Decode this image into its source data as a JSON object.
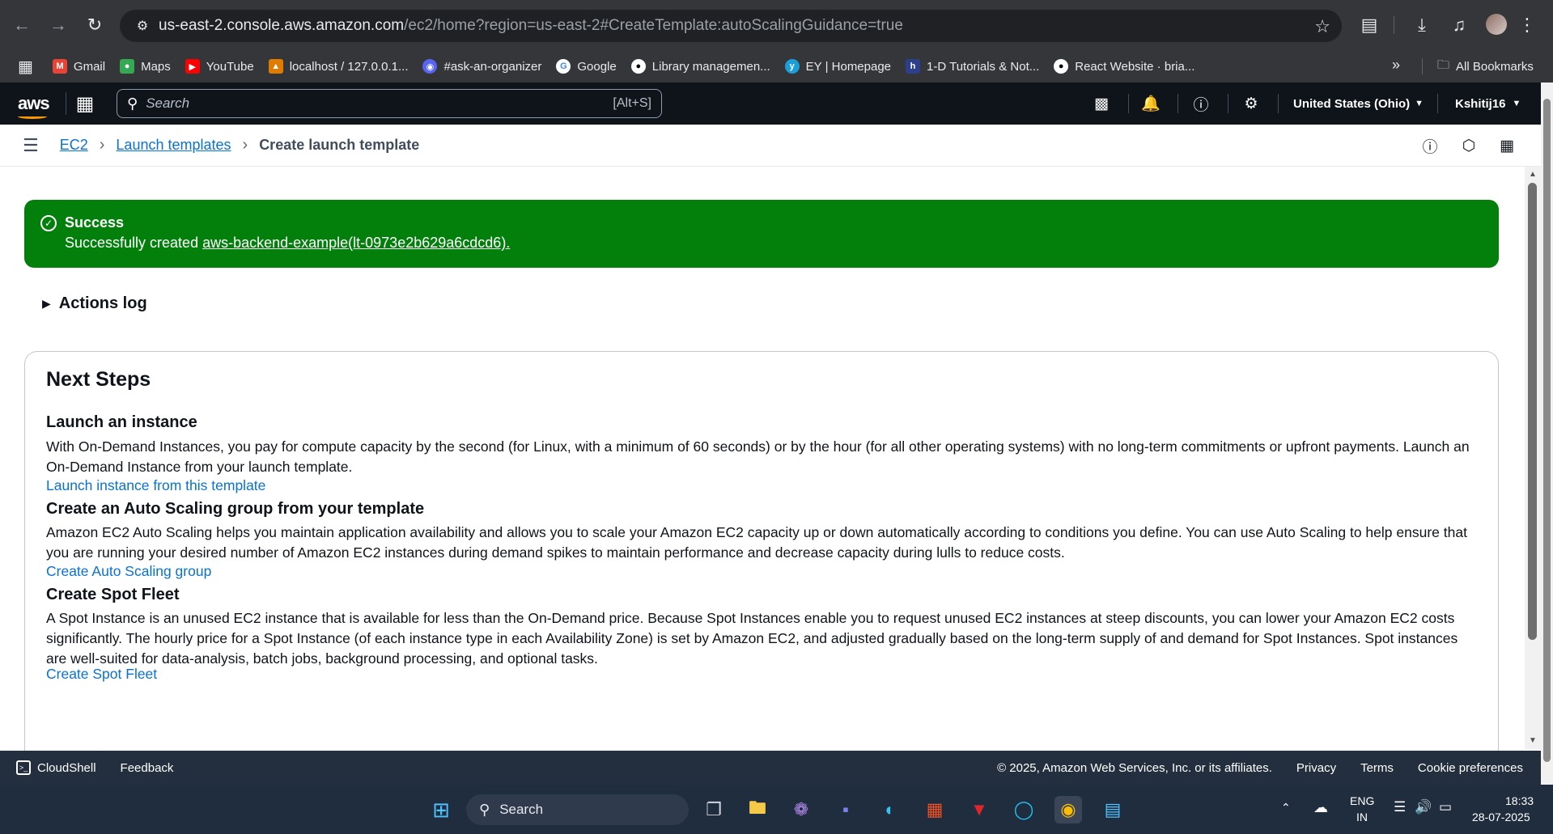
{
  "browser": {
    "url_host": "us-east-2.console.aws.amazon.com",
    "url_path": "/ec2/home?region=us-east-2#CreateTemplate:autoScalingGuidance=true",
    "bookmarks": [
      "Gmail",
      "Maps",
      "YouTube",
      "localhost / 127.0.0.1...",
      "#ask-an-organizer",
      "Google",
      "Library managemen...",
      "EY | Homepage",
      "1-D Tutorials & Not...",
      "React Website · bria..."
    ],
    "all_bookmarks_label": "All Bookmarks"
  },
  "aws_header": {
    "logo_text": "aws",
    "search_placeholder": "Search",
    "search_shortcut": "[Alt+S]",
    "region": "United States (Ohio)",
    "account": "Kshitij16"
  },
  "breadcrumb": {
    "items": [
      "EC2",
      "Launch templates"
    ],
    "current": "Create launch template"
  },
  "flash": {
    "title": "Success",
    "message_prefix": "Successfully created ",
    "message_link": "aws-backend-example(lt-0973e2b629a6cdcd6).",
    "bg_color": "#037f0c"
  },
  "actions_log_label": "Actions log",
  "next_steps": {
    "title": "Next Steps",
    "sections": [
      {
        "heading": "Launch an instance",
        "text": "With On-Demand Instances, you pay for compute capacity by the second (for Linux, with a minimum of 60 seconds) or by the hour (for all other operating systems) with no long-term commitments or upfront payments. Launch an On-Demand Instance from your launch template.",
        "link": "Launch instance from this template"
      },
      {
        "heading": "Create an Auto Scaling group from your template",
        "text": "Amazon EC2 Auto Scaling helps you maintain application availability and allows you to scale your Amazon EC2 capacity up or down automatically according to conditions you define. You can use Auto Scaling to help ensure that you are running your desired number of Amazon EC2 instances during demand spikes to maintain performance and decrease capacity during lulls to reduce costs.",
        "link": "Create Auto Scaling group"
      },
      {
        "heading": "Create Spot Fleet",
        "text": "A Spot Instance is an unused EC2 instance that is available for less than the On-Demand price. Because Spot Instances enable you to request unused EC2 instances at steep discounts, you can lower your Amazon EC2 costs significantly. The hourly price for a Spot Instance (of each instance type in each Availability Zone) is set by Amazon EC2, and adjusted gradually based on the long-term supply of and demand for Spot Instances. Spot instances are well-suited for data-analysis, batch jobs, background processing, and optional tasks.",
        "link": "Create Spot Fleet"
      }
    ]
  },
  "footer": {
    "cloudshell": "CloudShell",
    "feedback": "Feedback",
    "copyright": "© 2025, Amazon Web Services, Inc. or its affiliates.",
    "privacy": "Privacy",
    "terms": "Terms",
    "cookies": "Cookie preferences"
  },
  "taskbar": {
    "search_label": "Search",
    "lang_top": "ENG",
    "lang_bottom": "IN",
    "time": "18:33",
    "date": "28-07-2025"
  }
}
